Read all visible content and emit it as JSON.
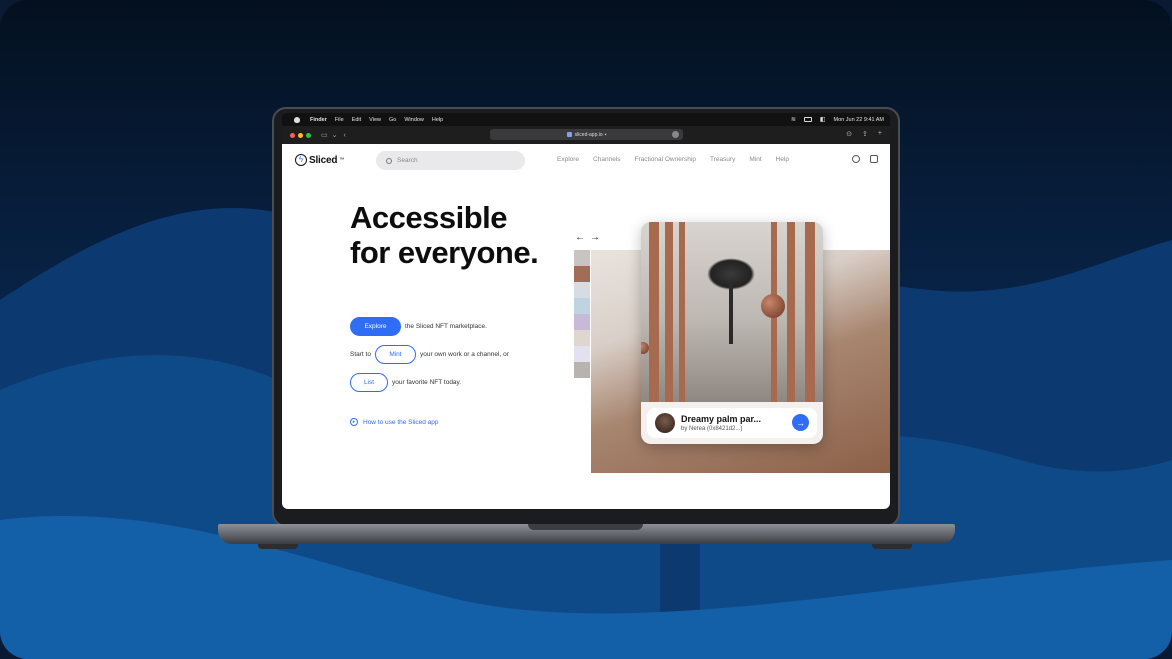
{
  "menubar": {
    "app": "Finder",
    "items": [
      "File",
      "Edit",
      "View",
      "Go",
      "Window",
      "Help"
    ],
    "datetime": "Mon Jun 22  9:41 AM"
  },
  "browser": {
    "url": "sliced-app.io"
  },
  "site": {
    "logo": "Sliced",
    "logo_mark": "™",
    "search_placeholder": "Search",
    "nav": [
      "Explore",
      "Channels",
      "Fractional Ownership",
      "Treasury",
      "Mint",
      "Help"
    ]
  },
  "hero": {
    "title_line1": "Accessible",
    "title_line2": "for everyone.",
    "explore_label": "Explore",
    "explore_text": "the Sliced NFT marketplace.",
    "start_text": "Start to",
    "mint_label": "Mint",
    "mint_text": "your own work or a channel, or",
    "list_label": "List",
    "list_text": "your favorite NFT today.",
    "howto": "How to use the Sliced app"
  },
  "gallery": {
    "prev_icon": "←",
    "next_icon": "→",
    "card_title": "Dreamy palm par...",
    "card_author": "by Nerea (0x8421d2...)"
  },
  "colors": {
    "accent": "#2f6df6",
    "background": "#082347"
  }
}
